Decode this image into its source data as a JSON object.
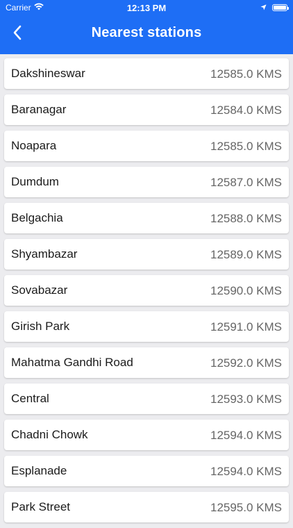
{
  "status_bar": {
    "carrier": "Carrier",
    "time": "12:13 PM",
    "wifi_icon": "wifi-icon",
    "location_icon": "location-arrow-icon",
    "battery_icon": "battery-icon",
    "battery_level": 1.0
  },
  "header": {
    "title": "Nearest stations",
    "back_icon": "chevron-left-icon",
    "color": "#1e6ef5"
  },
  "stations": [
    {
      "name": "Dakshineswar",
      "distance": "12585.0 KMS"
    },
    {
      "name": "Baranagar",
      "distance": "12584.0 KMS"
    },
    {
      "name": "Noapara",
      "distance": "12585.0 KMS"
    },
    {
      "name": "Dumdum",
      "distance": "12587.0 KMS"
    },
    {
      "name": "Belgachia",
      "distance": "12588.0 KMS"
    },
    {
      "name": "Shyambazar",
      "distance": "12589.0 KMS"
    },
    {
      "name": "Sovabazar",
      "distance": "12590.0 KMS"
    },
    {
      "name": "Girish Park",
      "distance": "12591.0 KMS"
    },
    {
      "name": "Mahatma Gandhi Road",
      "distance": "12592.0 KMS"
    },
    {
      "name": "Central",
      "distance": "12593.0 KMS"
    },
    {
      "name": "Chadni Chowk",
      "distance": "12594.0 KMS"
    },
    {
      "name": "Esplanade",
      "distance": "12594.0 KMS"
    },
    {
      "name": "Park Street",
      "distance": "12595.0 KMS"
    }
  ]
}
